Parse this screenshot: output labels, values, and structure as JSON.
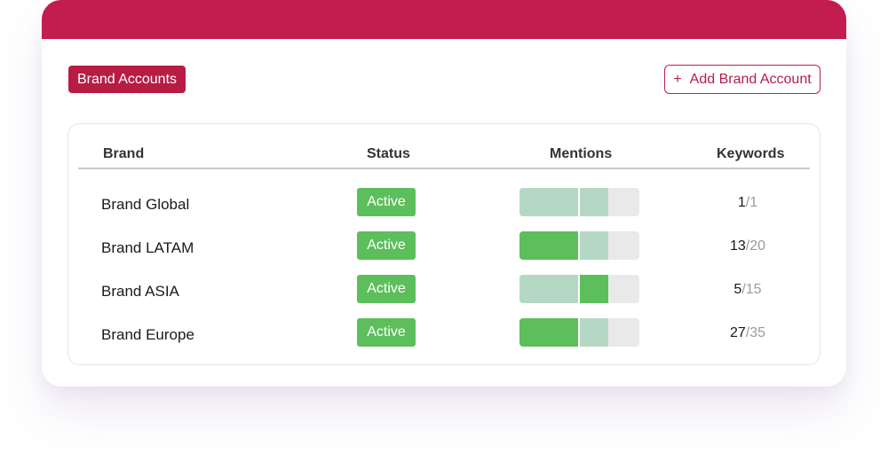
{
  "title": "Brand Accounts",
  "add_button": {
    "icon": "plus-icon",
    "label": "Add Brand Account"
  },
  "colors": {
    "header": "#c21d4e",
    "active": "#5cbf5c",
    "light_green": "#b5d8c4",
    "track": "#e9e9e9"
  },
  "table": {
    "columns": [
      "Brand",
      "Status",
      "Mentions",
      "Keywords"
    ],
    "rows": [
      {
        "brand": "Brand Global",
        "status": "Active",
        "mentions_segments": [
          "light",
          "light"
        ],
        "keywords_used": "1",
        "keywords_total": "/1"
      },
      {
        "brand": "Brand LATAM",
        "status": "Active",
        "mentions_segments": [
          "dark",
          "light"
        ],
        "keywords_used": "13",
        "keywords_total": "/20"
      },
      {
        "brand": "Brand ASIA",
        "status": "Active",
        "mentions_segments": [
          "light",
          "dark"
        ],
        "keywords_used": "5",
        "keywords_total": "/15"
      },
      {
        "brand": "Brand Europe",
        "status": "Active",
        "mentions_segments": [
          "dark",
          "light"
        ],
        "keywords_used": "27",
        "keywords_total": "/35"
      }
    ]
  }
}
